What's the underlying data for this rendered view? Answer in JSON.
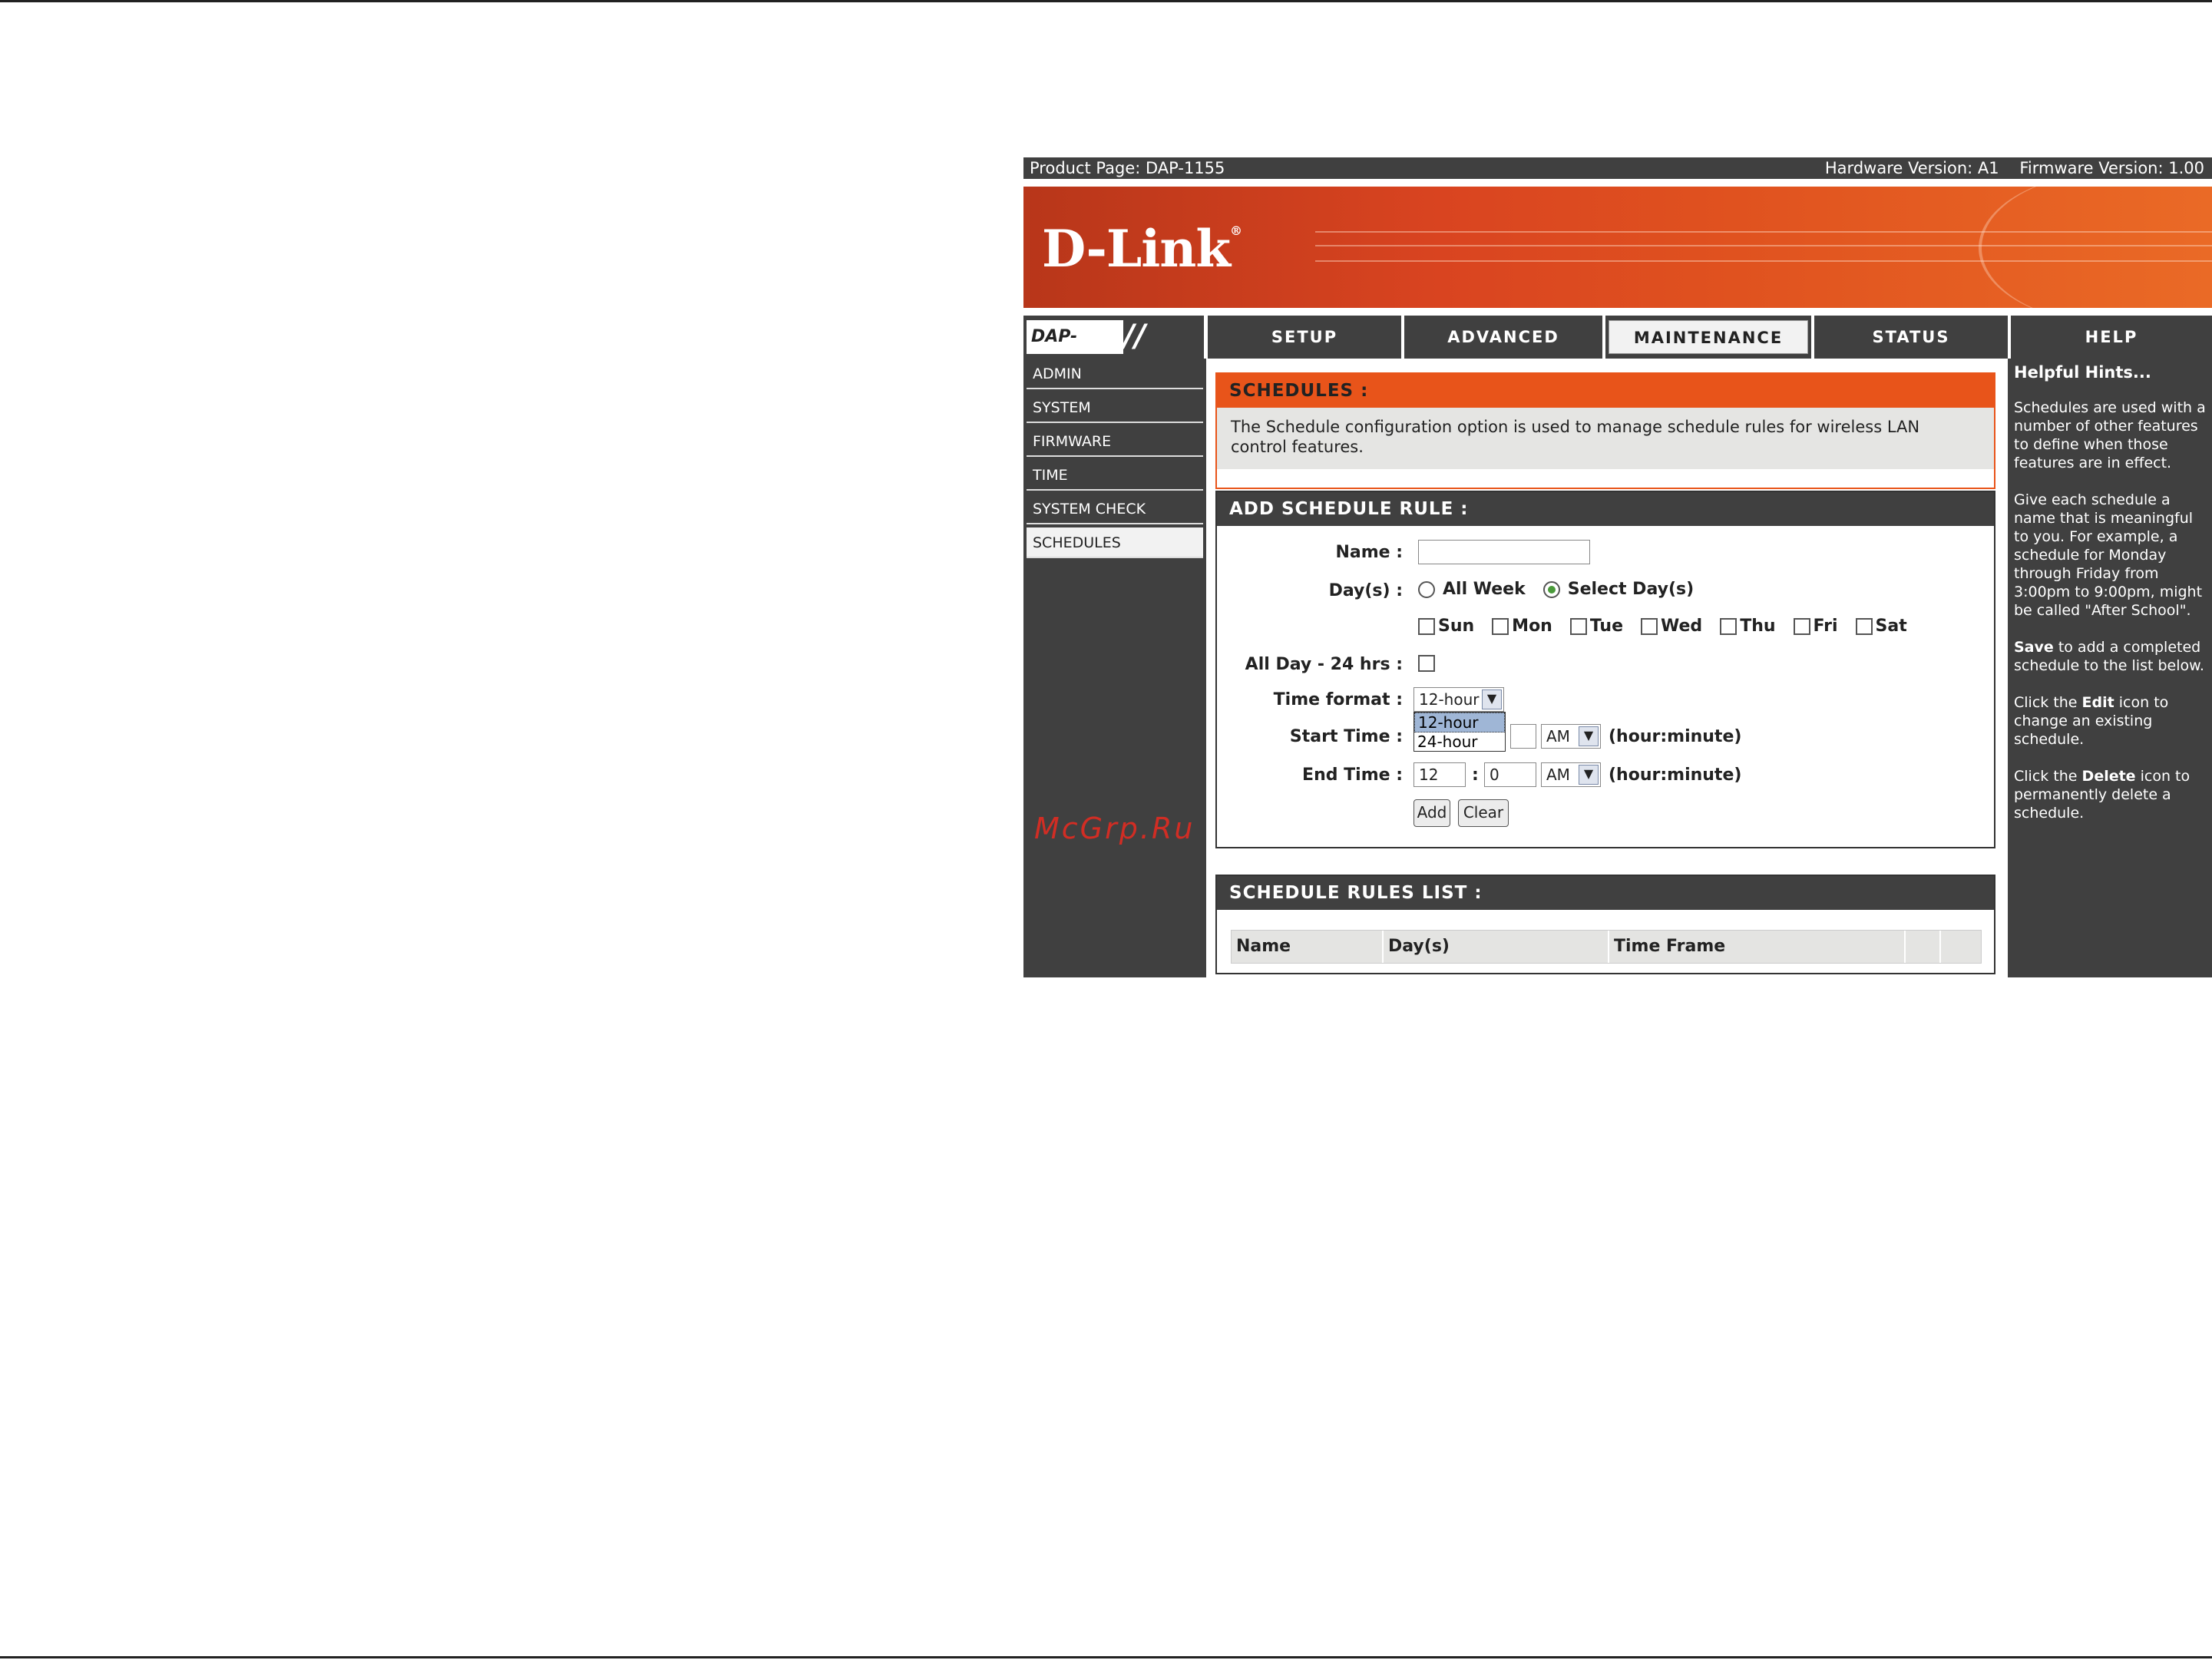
{
  "topbar": {
    "product": "Product Page: DAP-1155",
    "hardware": "Hardware Version: A1",
    "firmware": "Firmware Version: 1.00"
  },
  "brand": {
    "logo": "D-Link",
    "reg": "®",
    "model": "DAP-1155"
  },
  "nav": {
    "tabs": [
      "SETUP",
      "ADVANCED",
      "MAINTENANCE",
      "STATUS",
      "HELP"
    ],
    "active": "MAINTENANCE"
  },
  "sidebar": {
    "items": [
      "ADMIN",
      "SYSTEM",
      "FIRMWARE",
      "TIME",
      "SYSTEM CHECK",
      "SCHEDULES"
    ],
    "active": "SCHEDULES"
  },
  "watermark": "McGrp.Ru",
  "schedules": {
    "title": "SCHEDULES :",
    "description": "The Schedule configuration option is used to manage schedule rules for wireless LAN control features."
  },
  "add_rule": {
    "title": "ADD SCHEDULE RULE :",
    "name_label": "Name :",
    "name_value": "",
    "days_label": "Day(s) :",
    "all_week": "All Week",
    "select_days": "Select Day(s)",
    "days": [
      "Sun",
      "Mon",
      "Tue",
      "Wed",
      "Thu",
      "Fri",
      "Sat"
    ],
    "allday_label": "All Day - 24 hrs :",
    "time_format_label": "Time format :",
    "time_format_value": "12-hour",
    "time_format_options": [
      "12-hour",
      "24-hour"
    ],
    "start_label": "Start Time :",
    "start_ampm": "AM",
    "end_label": "End Time :",
    "end_hour": "12",
    "end_colon": ":",
    "end_minute": "0",
    "end_ampm": "AM",
    "unit": "(hour:minute)",
    "add_button": "Add",
    "clear_button": "Clear"
  },
  "rules_list": {
    "title": "SCHEDULE RULES LIST :",
    "columns": [
      "Name",
      "Day(s)",
      "Time Frame"
    ]
  },
  "hints": {
    "title": "Helpful Hints...",
    "p1": "Schedules are used with a number of other features to define when those features are in effect.",
    "p2": "Give each schedule a name that is meaningful to you. For example, a schedule for Monday through Friday from 3:00pm to 9:00pm, might be called \"After School\".",
    "p3_bold": "Save",
    "p3": " to add a completed schedule to the list below.",
    "p4_pre": "Click the ",
    "p4_bold": "Edit",
    "p4": " icon to change an existing schedule.",
    "p5_pre": "Click the ",
    "p5_bold": "Delete",
    "p5": " icon to permanently delete a schedule."
  },
  "colors": {
    "accent": "#e8541a",
    "dark": "#404040"
  }
}
